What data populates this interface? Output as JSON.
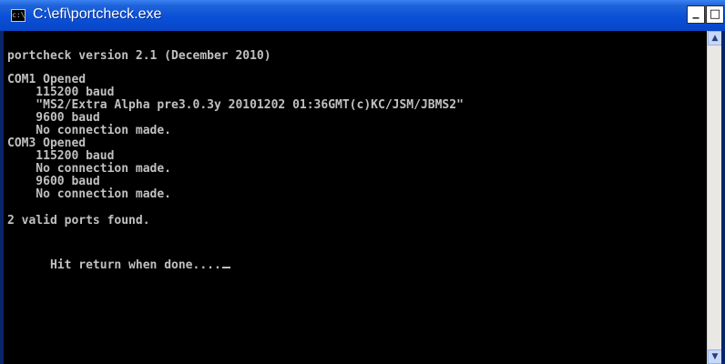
{
  "window": {
    "title": "C:\\efi\\portcheck.exe",
    "icon_text": "c:\\",
    "controls": {
      "minimize_glyph": "_",
      "maximize_glyph": "□"
    }
  },
  "console": {
    "lines": [
      "portcheck version 2.1 (December 2010)",
      "COM1 Opened",
      "    115200 baud",
      "    \"MS2/Extra Alpha pre3.0.3y 20101202 01:36GMT(c)KC/JSM/JBMS2\"",
      "    9600 baud",
      "    No connection made.",
      "COM3 Opened",
      "    115200 baud",
      "    No connection made.",
      "    9600 baud",
      "    No connection made.",
      "2 valid ports found.",
      "Hit return when done...."
    ]
  },
  "scrollbar": {
    "up_glyph": "▲",
    "down_glyph": "▼"
  },
  "colors": {
    "titlebar": "#0a50d8",
    "console_bg": "#000000",
    "console_text": "#c0c0c0"
  }
}
